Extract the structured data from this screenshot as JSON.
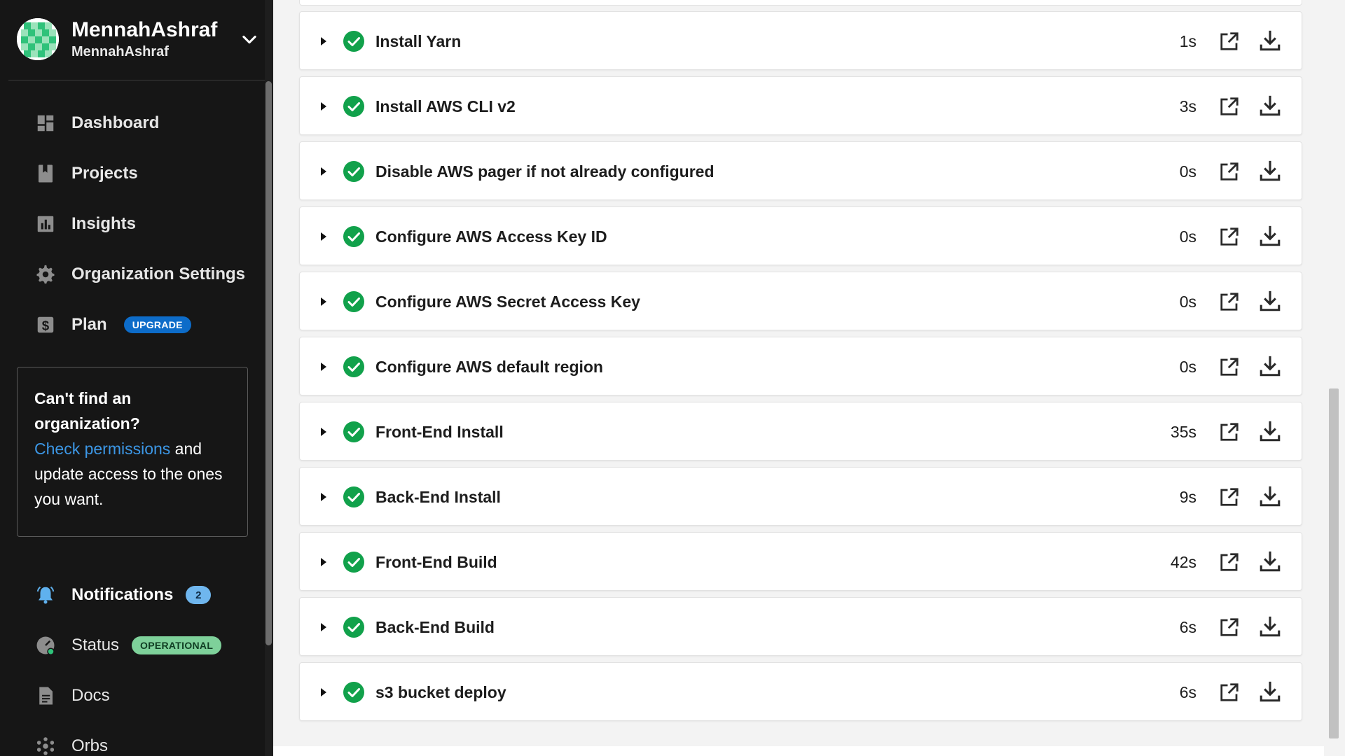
{
  "user": {
    "name": "MennahAshraf",
    "handle": "MennahAshraf"
  },
  "nav": {
    "dashboard": "Dashboard",
    "projects": "Projects",
    "insights": "Insights",
    "org_settings": "Organization Settings",
    "plan": "Plan",
    "plan_badge": "UPGRADE"
  },
  "org_card": {
    "title": "Can't find an organization?",
    "link": "Check permissions",
    "text_after_link": " and update access to the ones you want."
  },
  "nav_bottom": {
    "notifications": "Notifications",
    "notifications_count": "2",
    "status": "Status",
    "status_badge": "OPERATIONAL",
    "docs": "Docs",
    "orbs": "Orbs"
  },
  "steps": [
    {
      "name": "Install Yarn",
      "duration": "1s",
      "status": "success"
    },
    {
      "name": "Install AWS CLI v2",
      "duration": "3s",
      "status": "success"
    },
    {
      "name": "Disable AWS pager if not already configured",
      "duration": "0s",
      "status": "success"
    },
    {
      "name": "Configure AWS Access Key ID",
      "duration": "0s",
      "status": "success"
    },
    {
      "name": "Configure AWS Secret Access Key",
      "duration": "0s",
      "status": "success"
    },
    {
      "name": "Configure AWS default region",
      "duration": "0s",
      "status": "success"
    },
    {
      "name": "Front-End Install",
      "duration": "35s",
      "status": "success"
    },
    {
      "name": "Back-End Install",
      "duration": "9s",
      "status": "success"
    },
    {
      "name": "Front-End Build",
      "duration": "42s",
      "status": "success"
    },
    {
      "name": "Back-End Build",
      "duration": "6s",
      "status": "success"
    },
    {
      "name": "s3 bucket deploy",
      "duration": "6s",
      "status": "success"
    }
  ],
  "colors": {
    "sidebar_bg": "#161616",
    "success_green": "#11a14b",
    "link_blue": "#3c97e6",
    "upgrade_badge": "#0d6cc9",
    "status_badge": "#7ed19a"
  }
}
